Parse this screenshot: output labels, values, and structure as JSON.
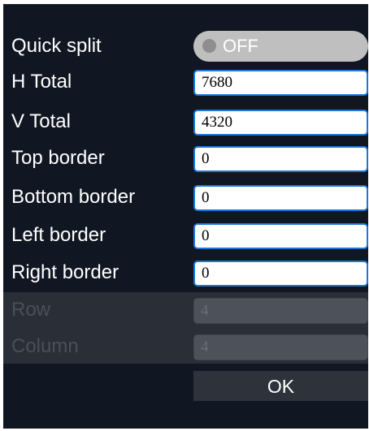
{
  "quick_split": {
    "label": "Quick split",
    "state": "OFF"
  },
  "fields": {
    "h_total": {
      "label": "H Total",
      "value": "7680"
    },
    "v_total": {
      "label": "V Total",
      "value": "4320"
    },
    "top_border": {
      "label": "Top border",
      "value": "0"
    },
    "bottom_border": {
      "label": "Bottom border",
      "value": "0"
    },
    "left_border": {
      "label": "Left border",
      "value": "0"
    },
    "right_border": {
      "label": "Right border",
      "value": "0"
    },
    "row": {
      "label": "Row",
      "value": "4"
    },
    "column": {
      "label": "Column",
      "value": "4"
    }
  },
  "ok_label": "OK",
  "colors": {
    "panel_bg": "#111722",
    "field_border": "#1e78d7",
    "toggle_bg": "#bfbfbf",
    "disabled_bg": "#2a2e37"
  }
}
